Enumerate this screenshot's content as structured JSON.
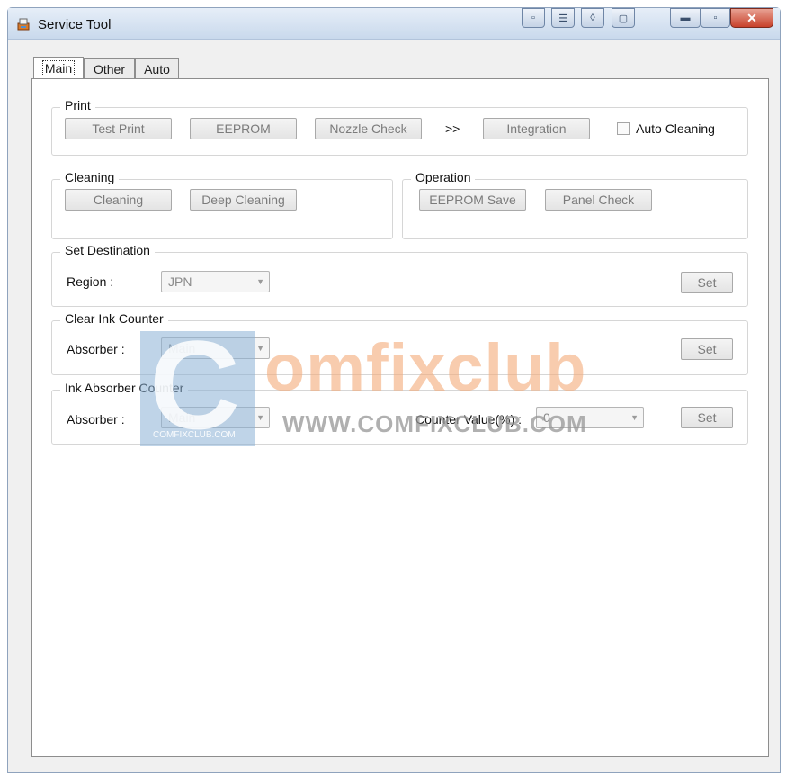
{
  "window": {
    "title": "Service Tool",
    "close_label": "✕"
  },
  "tabs": [
    {
      "label": "Main",
      "active": true
    },
    {
      "label": "Other",
      "active": false
    },
    {
      "label": "Auto",
      "active": false
    }
  ],
  "print": {
    "title": "Print",
    "test_print": "Test Print",
    "eeprom": "EEPROM",
    "nozzle_check": "Nozzle Check",
    "arrow": ">>",
    "integration": "Integration",
    "auto_cleaning": "Auto Cleaning"
  },
  "cleaning": {
    "title": "Cleaning",
    "cleaning": "Cleaning",
    "deep_cleaning": "Deep Cleaning"
  },
  "operation": {
    "title": "Operation",
    "eeprom_save": "EEPROM Save",
    "panel_check": "Panel Check"
  },
  "set_destination": {
    "title": "Set Destination",
    "region_label": "Region :",
    "region_value": "JPN",
    "set": "Set"
  },
  "clear_ink_counter": {
    "title": "Clear Ink Counter",
    "absorber_label": "Absorber :",
    "absorber_value": "Main",
    "set": "Set"
  },
  "ink_absorber_counter": {
    "title": "Ink Absorber Counter",
    "absorber_label": "Absorber :",
    "absorber_value": "Main",
    "counter_label": "Counter Value(%) :",
    "counter_value": "0",
    "set": "Set"
  },
  "watermark": {
    "brand": "omfixclub",
    "url": "WWW.COMFIXCLUB.COM",
    "small": "COMFIXCLUB.COM"
  }
}
